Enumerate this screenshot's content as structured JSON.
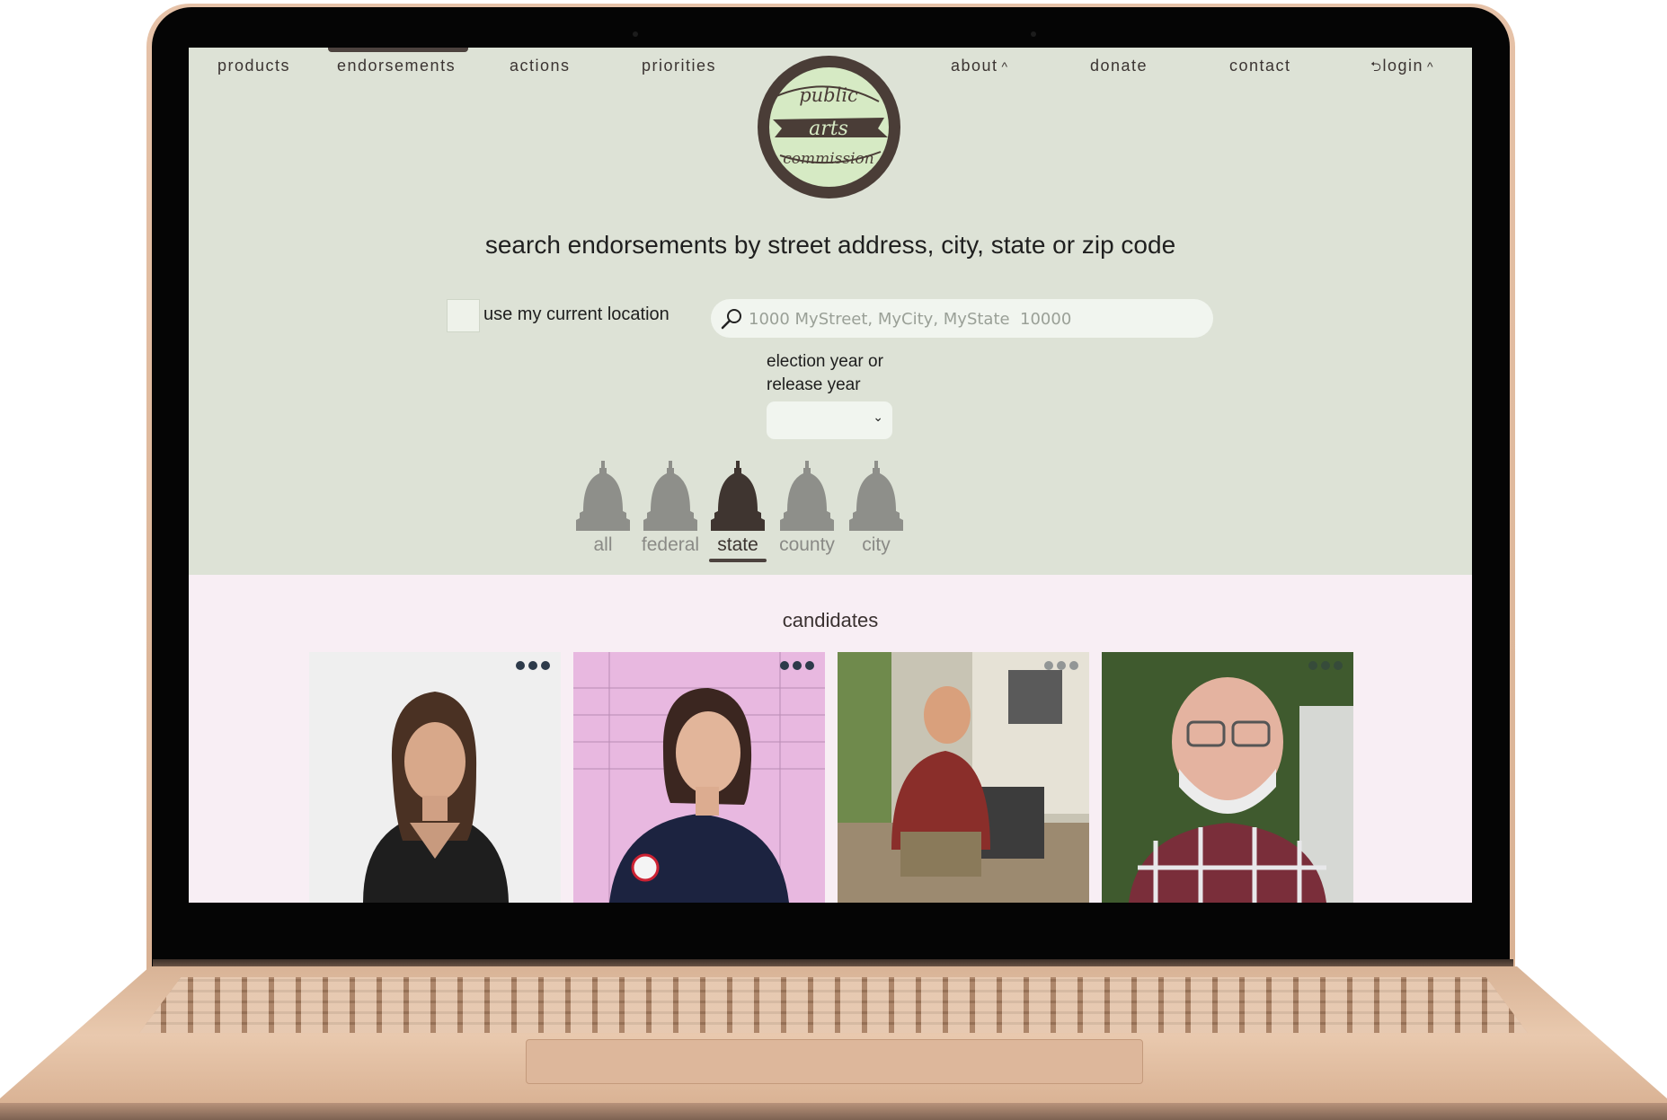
{
  "nav": {
    "items": [
      "products",
      "endorsements",
      "actions",
      "priorities"
    ],
    "about": "about",
    "donate": "donate",
    "contact": "contact",
    "login": "login",
    "active": "endorsements"
  },
  "logo": {
    "line1": "public",
    "line2": "arts",
    "line3": "commission"
  },
  "search": {
    "title": "search endorsements by street address, city, state or zip code",
    "use_location_label": "use my current location",
    "placeholder": "1000 MyStreet, MyCity, MyState  10000",
    "year_label_line1": "election year or",
    "year_label_line2": "release year",
    "year_selected": ""
  },
  "filters": {
    "items": [
      "all",
      "federal",
      "state",
      "county",
      "city"
    ],
    "selected": "state"
  },
  "candidates": {
    "title": "candidates",
    "cards": [
      {
        "menu_icon": "more-dots-icon"
      },
      {
        "menu_icon": "more-dots-icon"
      },
      {
        "menu_icon": "more-dots-icon"
      },
      {
        "menu_icon": "more-dots-icon"
      }
    ]
  },
  "colors": {
    "top_bg": "#dde2d6",
    "bottom_bg": "#f8eef4",
    "logo_ring": "#4a3d37",
    "logo_fill": "#d6eac4",
    "accent_dark": "#4c423e",
    "inactive_icon": "#8e8f8a"
  }
}
